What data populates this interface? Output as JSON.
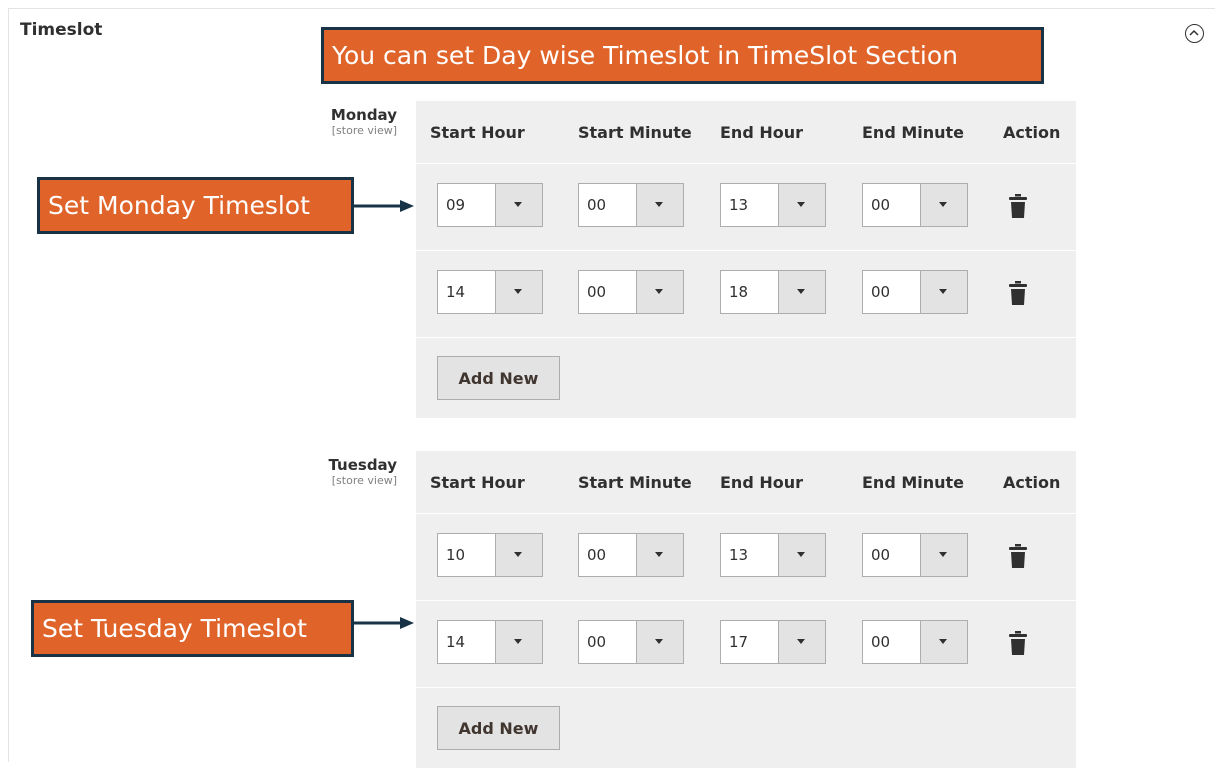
{
  "section": {
    "title": "Timeslot"
  },
  "callouts": {
    "top": "You can set Day wise Timeslot in TimeSlot Section",
    "monday": "Set Monday Timeslot",
    "tuesday": "Set Tuesday Timeslot"
  },
  "columns": [
    "Start Hour",
    "Start Minute",
    "End Hour",
    "End Minute",
    "Action"
  ],
  "days": [
    {
      "name": "Monday",
      "scope": "[store view]",
      "rows": [
        {
          "start_hour": "09",
          "start_minute": "00",
          "end_hour": "13",
          "end_minute": "00"
        },
        {
          "start_hour": "14",
          "start_minute": "00",
          "end_hour": "18",
          "end_minute": "00"
        }
      ],
      "add_label": "Add New"
    },
    {
      "name": "Tuesday",
      "scope": "[store view]",
      "rows": [
        {
          "start_hour": "10",
          "start_minute": "00",
          "end_hour": "13",
          "end_minute": "00"
        },
        {
          "start_hour": "14",
          "start_minute": "00",
          "end_hour": "17",
          "end_minute": "00"
        }
      ],
      "add_label": "Add New"
    }
  ],
  "icons": {
    "collapse": "collapse-icon",
    "delete": "trash-icon",
    "dropdown": "chevron-down-icon"
  },
  "colors": {
    "callout_bg": "#e0642a",
    "callout_border": "#173345",
    "grid_bg": "#efefef"
  }
}
